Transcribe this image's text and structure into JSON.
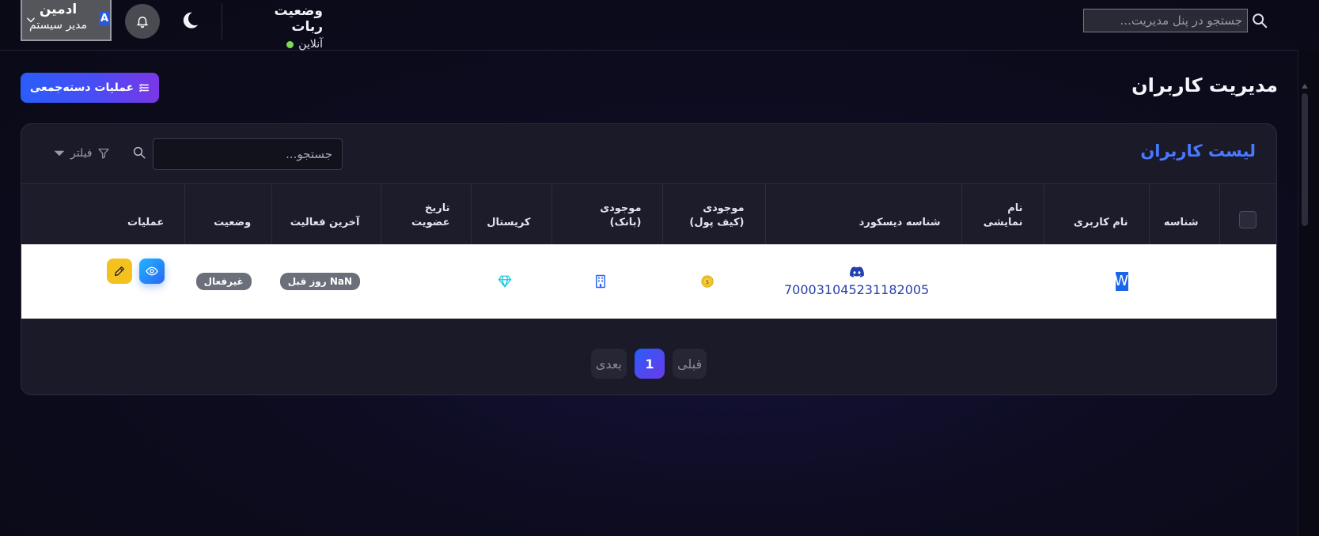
{
  "header": {
    "search_placeholder": "جستجو در پنل مدیریت...",
    "bot_status_title": "وضعیت ربات",
    "bot_status_value": "آنلاین",
    "user_name": "ادمین",
    "user_role": "مدیر سیستم",
    "user_avatar_letter": "A",
    "status_color": "#7ed957"
  },
  "page": {
    "title": "مدیریت کاربران",
    "bulk_button": "عملیات دسته‌جمعی"
  },
  "card": {
    "title": "لیست کاربران",
    "search_placeholder": "جستجو...",
    "filter_label": "فیلتر"
  },
  "table": {
    "columns": {
      "id": "شناسه",
      "username": "نام کاربری",
      "display_name": "نام نمایشی",
      "discord_id": "شناسه دیسکورد",
      "wallet": "موجودی (کیف پول)",
      "bank": "موجودی (بانک)",
      "crystal": "کریستال",
      "joined": "تاریخ عضویت",
      "last_activity": "آخرین فعالیت",
      "status": "وضعیت",
      "actions": "عملیات"
    },
    "rows": [
      {
        "id": "",
        "username_avatar": "W",
        "display_name": "",
        "discord_id": "700031045231182005",
        "joined": "",
        "last_activity": "NaN روز قبل",
        "status": "غیرفعال"
      }
    ]
  },
  "pagination": {
    "prev": "قبلی",
    "current": "1",
    "next": "بعدی"
  },
  "icons": {
    "search": "search-icon",
    "theme": "moon-icon",
    "notifications": "bell-icon",
    "discord": "discord-icon",
    "wallet": "coin-icon",
    "bank": "building-icon",
    "crystal": "diamond-icon",
    "view": "eye-icon",
    "edit": "pencil-icon"
  },
  "colors": {
    "accent": "#4a78ff",
    "view_button": "#1fb6ff",
    "edit_button": "#f4c21f",
    "coin": "#f2c230",
    "bank": "#2a66f4",
    "crystal": "#1ec8e8"
  }
}
